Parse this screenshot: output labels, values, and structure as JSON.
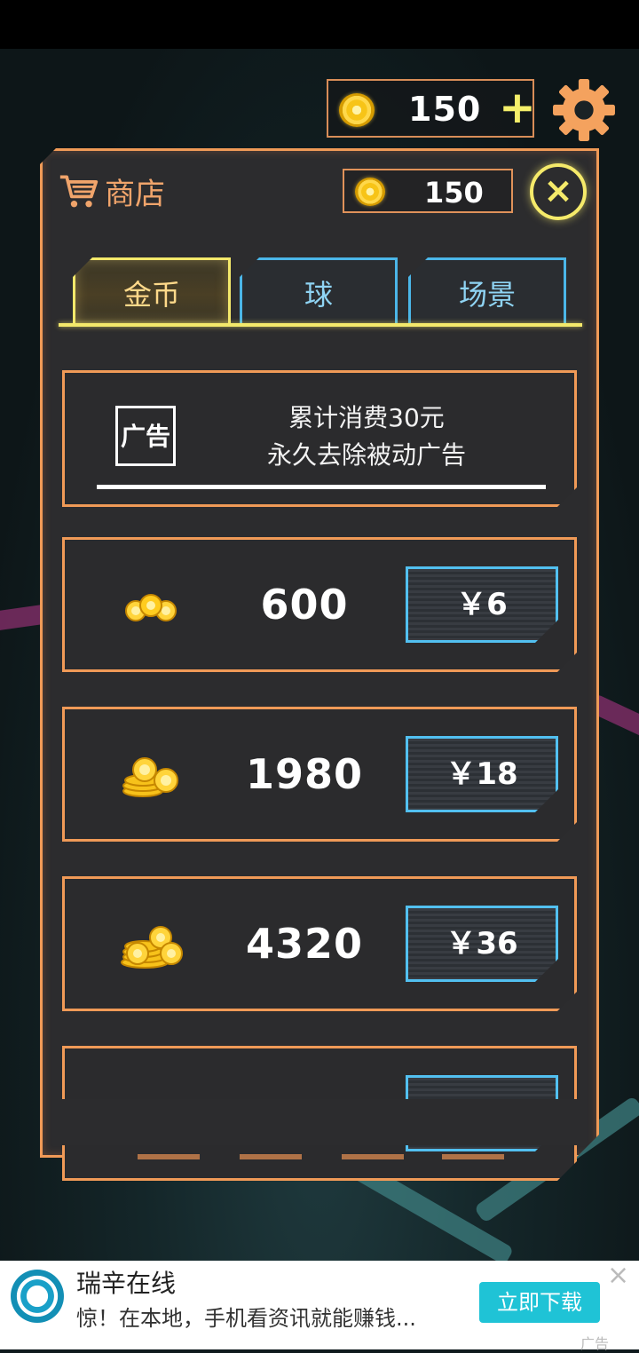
{
  "hud": {
    "coins": "150",
    "plus": "+"
  },
  "shop": {
    "title": "商店",
    "coins": "150",
    "close_symbol": "×",
    "tabs": [
      {
        "label": "金币",
        "active": true
      },
      {
        "label": "球",
        "active": false
      },
      {
        "label": "场景",
        "active": false
      }
    ],
    "ad_offer": {
      "icon_label": "广告",
      "line1": "累计消费30元",
      "line2": "永久去除被动广告"
    },
    "items": [
      {
        "amount": "600",
        "price": "￥6",
        "icon": "coins-small-icon"
      },
      {
        "amount": "1980",
        "price": "￥18",
        "icon": "coins-medium-icon"
      },
      {
        "amount": "4320",
        "price": "￥36",
        "icon": "coins-large-icon"
      }
    ]
  },
  "banner": {
    "app_name": "瑞辛在线",
    "description": "惊！在本地，手机看资讯就能赚钱...",
    "download_label": "立即下载",
    "ad_tag": "广告",
    "close_symbol": "×"
  },
  "colors": {
    "panel_border": "#f09a57",
    "tab_active": "#f4e96b",
    "tab_inactive": "#4bb6e8",
    "price_border": "#52c0f0",
    "download_button": "#1fc3d6"
  }
}
